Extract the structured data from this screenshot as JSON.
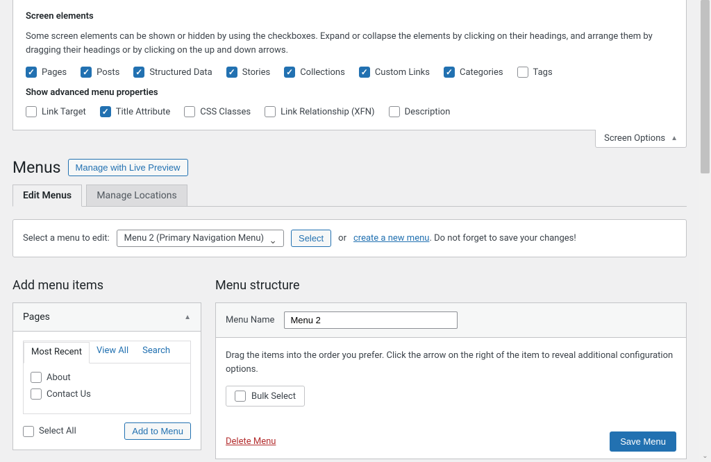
{
  "screenOptions": {
    "heading1": "Screen elements",
    "description": "Some screen elements can be shown or hidden by using the checkboxes. Expand or collapse the elements by clicking on their headings, and arrange them by dragging their headings or by clicking on the up and down arrows.",
    "elements": [
      {
        "label": "Pages",
        "checked": true
      },
      {
        "label": "Posts",
        "checked": true
      },
      {
        "label": "Structured Data",
        "checked": true
      },
      {
        "label": "Stories",
        "checked": true
      },
      {
        "label": "Collections",
        "checked": true
      },
      {
        "label": "Custom Links",
        "checked": true
      },
      {
        "label": "Categories",
        "checked": true
      },
      {
        "label": "Tags",
        "checked": false
      }
    ],
    "heading2": "Show advanced menu properties",
    "advanced": [
      {
        "label": "Link Target",
        "checked": false
      },
      {
        "label": "Title Attribute",
        "checked": true
      },
      {
        "label": "CSS Classes",
        "checked": false
      },
      {
        "label": "Link Relationship (XFN)",
        "checked": false
      },
      {
        "label": "Description",
        "checked": false
      }
    ],
    "tabLabel": "Screen Options"
  },
  "header": {
    "title": "Menus",
    "previewButton": "Manage with Live Preview"
  },
  "tabs": {
    "edit": "Edit Menus",
    "locations": "Manage Locations"
  },
  "selectBar": {
    "label": "Select a menu to edit:",
    "selected": "Menu 2 (Primary Navigation Menu)",
    "selectButton": "Select",
    "orText": "or",
    "createLink": "create a new menu",
    "reminder": ". Do not forget to save your changes!"
  },
  "addItems": {
    "heading": "Add menu items",
    "pagesBox": {
      "title": "Pages",
      "tabs": {
        "recent": "Most Recent",
        "viewAll": "View All",
        "search": "Search"
      },
      "items": [
        {
          "label": "About"
        },
        {
          "label": "Contact Us"
        }
      ],
      "selectAll": "Select All",
      "addButton": "Add to Menu"
    }
  },
  "structure": {
    "heading": "Menu structure",
    "nameLabel": "Menu Name",
    "nameValue": "Menu 2",
    "description": "Drag the items into the order you prefer. Click the arrow on the right of the item to reveal additional configuration options.",
    "bulkSelect": "Bulk Select",
    "deleteLink": "Delete Menu",
    "saveButton": "Save Menu"
  }
}
